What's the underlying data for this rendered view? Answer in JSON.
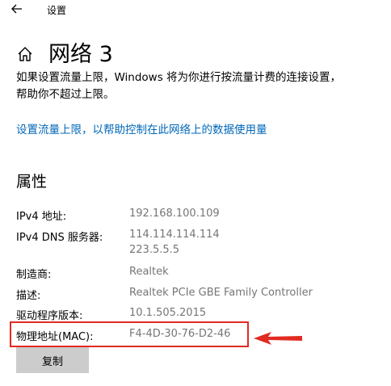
{
  "window": {
    "title": "设置"
  },
  "page": {
    "title": "网络 3"
  },
  "description": {
    "line1": "如果设置流量上限，Windows 将为你进行按流量计费的连接设置，",
    "line2": "帮助你不超过上限。"
  },
  "link": {
    "label": "设置流量上限，以帮助控制在此网络上的数据使用量"
  },
  "properties": {
    "heading": "属性",
    "items": [
      {
        "label": "IPv4 地址:",
        "values": [
          "192.168.100.109"
        ]
      },
      {
        "label": "IPv4 DNS 服务器:",
        "values": [
          "114.114.114.114",
          "223.5.5.5"
        ]
      },
      {
        "label": "制造商:",
        "values": [
          "Realtek"
        ]
      },
      {
        "label": "描述:",
        "values": [
          "Realtek PCIe GBE Family Controller"
        ]
      },
      {
        "label": "驱动程序版本:",
        "values": [
          "10.1.505.2015"
        ]
      },
      {
        "label": "物理地址(MAC):",
        "values": [
          "F4-4D-30-76-D2-46"
        ]
      }
    ]
  },
  "copy_button": {
    "label": "复制"
  },
  "colors": {
    "link": "#0067b8",
    "annotation": "#e12b22",
    "value_text": "#767676",
    "button_bg": "#cccccc"
  },
  "icons": {
    "back": "back-arrow-icon",
    "home": "home-icon"
  }
}
